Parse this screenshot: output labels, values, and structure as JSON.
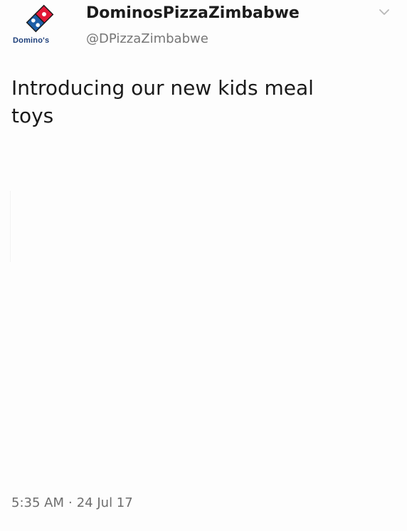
{
  "tweet": {
    "display_name": "DominosPizzaZimbabwe",
    "handle": "@DPizzaZimbabwe",
    "avatar": {
      "icon": "dominos-logo-icon",
      "label": "Domino's"
    },
    "menu_icon": "chevron-down-icon",
    "text_line1": "Introducing our new kids meal",
    "text_line2": "toys",
    "time": "5:35 AM",
    "separator": "·",
    "date": "24 Jul 17"
  },
  "colors": {
    "logo_blue": "#1d5fa8",
    "logo_red": "#e31837",
    "text_primary": "#1a1a1a",
    "text_secondary": "#767676"
  }
}
